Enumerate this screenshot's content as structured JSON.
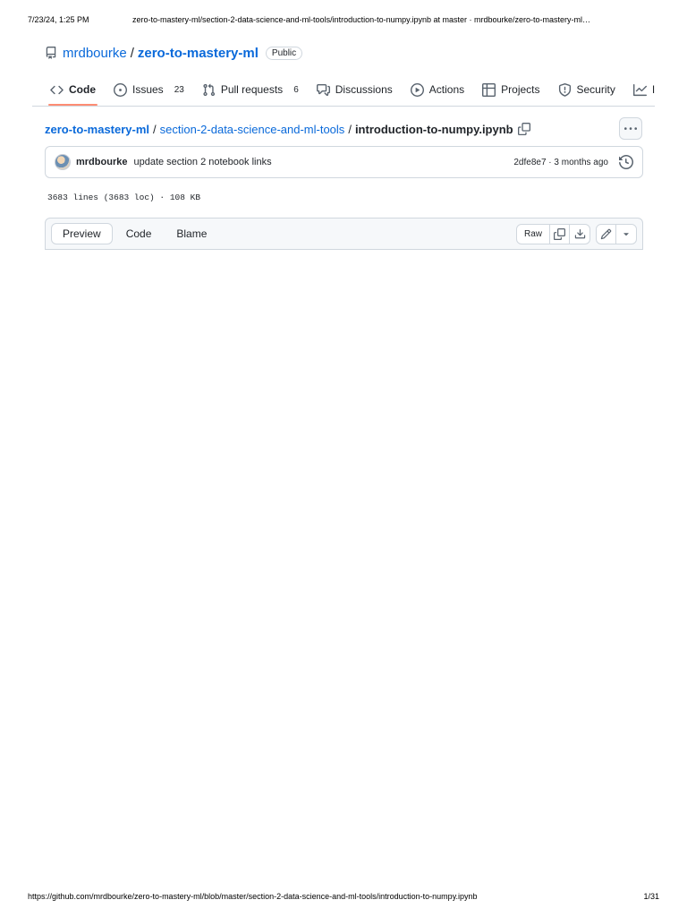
{
  "print": {
    "datetime": "7/23/24, 1:25 PM",
    "title": "zero-to-mastery-ml/section-2-data-science-and-ml-tools/introduction-to-numpy.ipynb at master · mrdbourke/zero-to-mastery-ml…",
    "url": "https://github.com/mrdbourke/zero-to-mastery-ml/blob/master/section-2-data-science-and-ml-tools/introduction-to-numpy.ipynb",
    "page": "1/31"
  },
  "repo": {
    "owner": "mrdbourke",
    "separator": "/",
    "name": "zero-to-mastery-ml",
    "visibility": "Public",
    "icon": "repo-icon"
  },
  "tabs": [
    {
      "label": "Code",
      "icon": "code-icon",
      "active": true
    },
    {
      "label": "Issues",
      "icon": "issue-icon",
      "count": "23"
    },
    {
      "label": "Pull requests",
      "icon": "pull-request-icon",
      "count": "6"
    },
    {
      "label": "Discussions",
      "icon": "discussions-icon"
    },
    {
      "label": "Actions",
      "icon": "play-icon"
    },
    {
      "label": "Projects",
      "icon": "table-icon"
    },
    {
      "label": "Security",
      "icon": "shield-icon"
    },
    {
      "label": "In",
      "icon": "graph-icon"
    }
  ],
  "breadcrumb": {
    "root": "zero-to-mastery-ml",
    "folder": "section-2-data-science-and-ml-tools",
    "file": "introduction-to-numpy.ipynb",
    "sep": "/"
  },
  "commit": {
    "author": "mrdbourke",
    "message": "update section 2 notebook links",
    "meta": "2dfe8e7 · 3 months ago"
  },
  "file_info": "3683 lines (3683 loc) · 108 KB",
  "toolbar": {
    "views": [
      "Preview",
      "Code",
      "Blame"
    ],
    "active_view": "Preview",
    "raw_label": "Raw"
  },
  "colors": {
    "link": "#0969da",
    "border": "#d0d7de",
    "active_tab_underline": "#fd8c73"
  }
}
